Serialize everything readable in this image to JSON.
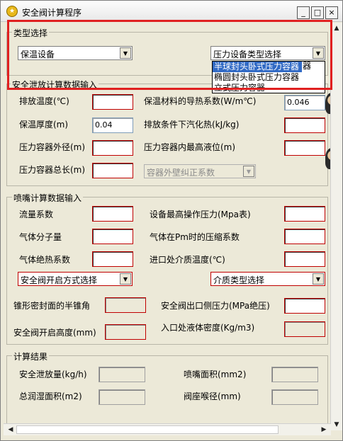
{
  "window": {
    "title": "安全阀计算程序",
    "controls": {
      "minimize": "_",
      "maximize": "□",
      "close": "×"
    }
  },
  "type_group": {
    "label": "类型选择",
    "insulation_select": "保温设备",
    "vessel_type_select": "压力设备类型选择",
    "vessel_type_options": [
      "半球封头卧式压力容器",
      "椭圆封头卧式压力容器",
      "立式压力容器"
    ],
    "hidden_option_tail": "器"
  },
  "relief_group": {
    "label": "安全泄放计算数据输入",
    "discharge_temp_label": "排放温度(℃)",
    "insulation_conductivity_label": "保温材料的导热系数(W/m℃)",
    "insulation_conductivity_value": "0.046",
    "insulation_thickness_label": "保温厚度(m)",
    "insulation_thickness_value": "0.04",
    "latent_heat_label": "排放条件下汽化热(kJ/kg)",
    "vessel_outer_diameter_label": "压力容器外径(m)",
    "max_liquid_level_label": "压力容器内最高液位(m)",
    "vessel_length_label": "压力容器总长(m)",
    "wall_factor_select": "容器外壁纠正系数"
  },
  "nozzle_group": {
    "label": "喷嘴计算数据输入",
    "flow_coeff_label": "流量系数",
    "max_operating_pressure_label": "设备最高操作压力(Mpa表)",
    "molecular_weight_label": "气体分子量",
    "compressibility_label": "气体在Pm时的压缩系数",
    "adiabatic_coeff_label": "气体绝热系数",
    "inlet_temp_label": "进口处介质温度(℃)",
    "opening_mode_select": "安全阀开启方式选择",
    "medium_type_select": "介质类型选择",
    "cone_half_angle_label": "锥形密封面的半锥角",
    "outlet_pressure_label": "安全阀出口侧压力(MPa绝压)",
    "lift_height_label": "安全阀开启高度(mm)",
    "inlet_liquid_density_label": "入口处液体密度(Kg/m3)"
  },
  "results_group": {
    "label": "计算结果",
    "relief_rate_label": "安全泄放量(kg/h)",
    "nozzle_area_label": "喷嘴面积(mm2)",
    "wetted_area_label": "总润湿面积(m2)",
    "seat_throat_label": "阀座喉径(mm)"
  },
  "scrollbars": {
    "left_arrow": "◀",
    "right_arrow": "▶",
    "up_arrow": "▲",
    "down_arrow": "▼"
  },
  "colors": {
    "invalid_border": "#c00000",
    "selection": "#316ac5",
    "highlight": "#e02020"
  }
}
